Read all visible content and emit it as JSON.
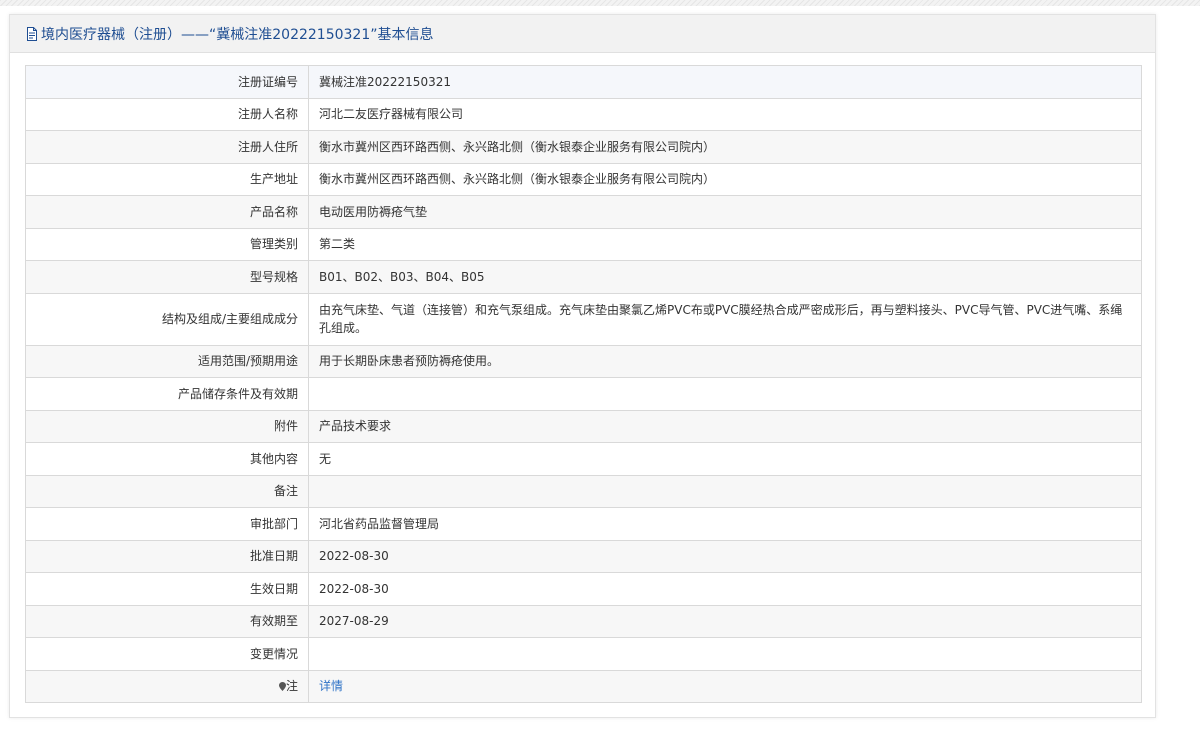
{
  "header": {
    "title": "境内医疗器械（注册）——“冀械注准20222150321”基本信息",
    "icon": "document-icon"
  },
  "rows": [
    {
      "label": "注册证编号",
      "value": "冀械注准20222150321"
    },
    {
      "label": "注册人名称",
      "value": "河北二友医疗器械有限公司"
    },
    {
      "label": "注册人住所",
      "value": "衡水市冀州区西环路西侧、永兴路北侧（衡水银泰企业服务有限公司院内）"
    },
    {
      "label": "生产地址",
      "value": "衡水市冀州区西环路西侧、永兴路北侧（衡水银泰企业服务有限公司院内）"
    },
    {
      "label": "产品名称",
      "value": "电动医用防褥疮气垫"
    },
    {
      "label": "管理类别",
      "value": "第二类"
    },
    {
      "label": "型号规格",
      "value": "B01、B02、B03、B04、B05"
    },
    {
      "label": "结构及组成/主要组成成分",
      "value": "由充气床垫、气道（连接管）和充气泵组成。充气床垫由聚氯乙烯PVC布或PVC膜经热合成严密成形后，再与塑料接头、PVC导气管、PVC进气嘴、系绳孔组成。"
    },
    {
      "label": "适用范围/预期用途",
      "value": "用于长期卧床患者预防褥疮使用。"
    },
    {
      "label": "产品储存条件及有效期",
      "value": ""
    },
    {
      "label": "附件",
      "value": "产品技术要求"
    },
    {
      "label": "其他内容",
      "value": "无"
    },
    {
      "label": "备注",
      "value": ""
    },
    {
      "label": "审批部门",
      "value": "河北省药品监督管理局"
    },
    {
      "label": "批准日期",
      "value": "2022-08-30"
    },
    {
      "label": "生效日期",
      "value": "2022-08-30"
    },
    {
      "label": "有效期至",
      "value": "2027-08-29"
    },
    {
      "label": "变更情况",
      "value": ""
    },
    {
      "label": "注",
      "value": "详情",
      "icon": "pin-icon"
    }
  ],
  "colors": {
    "title": "#1f4e92",
    "link": "#2f73c7",
    "header_bg": "#f2f2f2",
    "border": "#d9d9d9"
  }
}
